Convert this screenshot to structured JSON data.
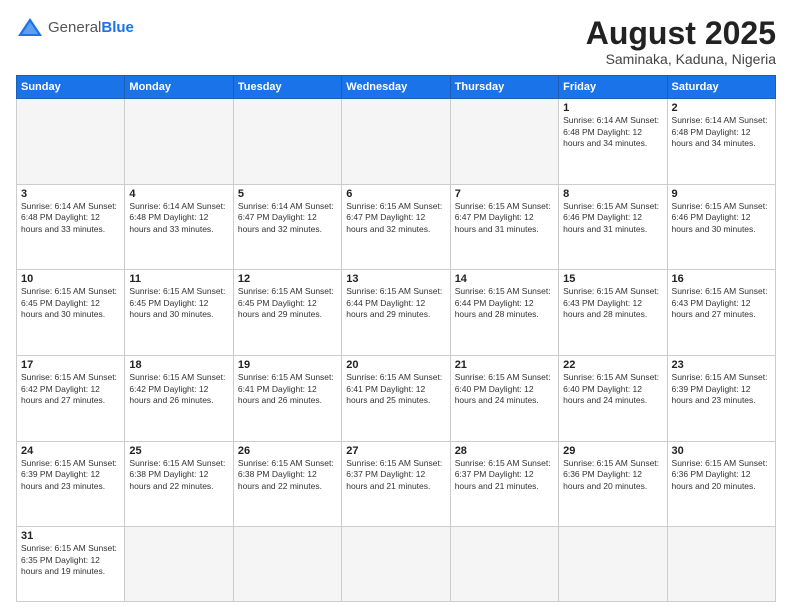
{
  "logo": {
    "text_general": "General",
    "text_blue": "Blue"
  },
  "header": {
    "title": "August 2025",
    "subtitle": "Saminaka, Kaduna, Nigeria"
  },
  "weekdays": [
    "Sunday",
    "Monday",
    "Tuesday",
    "Wednesday",
    "Thursday",
    "Friday",
    "Saturday"
  ],
  "weeks": [
    [
      {
        "day": "",
        "info": ""
      },
      {
        "day": "",
        "info": ""
      },
      {
        "day": "",
        "info": ""
      },
      {
        "day": "",
        "info": ""
      },
      {
        "day": "",
        "info": ""
      },
      {
        "day": "1",
        "info": "Sunrise: 6:14 AM\nSunset: 6:48 PM\nDaylight: 12 hours\nand 34 minutes."
      },
      {
        "day": "2",
        "info": "Sunrise: 6:14 AM\nSunset: 6:48 PM\nDaylight: 12 hours\nand 34 minutes."
      }
    ],
    [
      {
        "day": "3",
        "info": "Sunrise: 6:14 AM\nSunset: 6:48 PM\nDaylight: 12 hours\nand 33 minutes."
      },
      {
        "day": "4",
        "info": "Sunrise: 6:14 AM\nSunset: 6:48 PM\nDaylight: 12 hours\nand 33 minutes."
      },
      {
        "day": "5",
        "info": "Sunrise: 6:14 AM\nSunset: 6:47 PM\nDaylight: 12 hours\nand 32 minutes."
      },
      {
        "day": "6",
        "info": "Sunrise: 6:15 AM\nSunset: 6:47 PM\nDaylight: 12 hours\nand 32 minutes."
      },
      {
        "day": "7",
        "info": "Sunrise: 6:15 AM\nSunset: 6:47 PM\nDaylight: 12 hours\nand 31 minutes."
      },
      {
        "day": "8",
        "info": "Sunrise: 6:15 AM\nSunset: 6:46 PM\nDaylight: 12 hours\nand 31 minutes."
      },
      {
        "day": "9",
        "info": "Sunrise: 6:15 AM\nSunset: 6:46 PM\nDaylight: 12 hours\nand 30 minutes."
      }
    ],
    [
      {
        "day": "10",
        "info": "Sunrise: 6:15 AM\nSunset: 6:45 PM\nDaylight: 12 hours\nand 30 minutes."
      },
      {
        "day": "11",
        "info": "Sunrise: 6:15 AM\nSunset: 6:45 PM\nDaylight: 12 hours\nand 30 minutes."
      },
      {
        "day": "12",
        "info": "Sunrise: 6:15 AM\nSunset: 6:45 PM\nDaylight: 12 hours\nand 29 minutes."
      },
      {
        "day": "13",
        "info": "Sunrise: 6:15 AM\nSunset: 6:44 PM\nDaylight: 12 hours\nand 29 minutes."
      },
      {
        "day": "14",
        "info": "Sunrise: 6:15 AM\nSunset: 6:44 PM\nDaylight: 12 hours\nand 28 minutes."
      },
      {
        "day": "15",
        "info": "Sunrise: 6:15 AM\nSunset: 6:43 PM\nDaylight: 12 hours\nand 28 minutes."
      },
      {
        "day": "16",
        "info": "Sunrise: 6:15 AM\nSunset: 6:43 PM\nDaylight: 12 hours\nand 27 minutes."
      }
    ],
    [
      {
        "day": "17",
        "info": "Sunrise: 6:15 AM\nSunset: 6:42 PM\nDaylight: 12 hours\nand 27 minutes."
      },
      {
        "day": "18",
        "info": "Sunrise: 6:15 AM\nSunset: 6:42 PM\nDaylight: 12 hours\nand 26 minutes."
      },
      {
        "day": "19",
        "info": "Sunrise: 6:15 AM\nSunset: 6:41 PM\nDaylight: 12 hours\nand 26 minutes."
      },
      {
        "day": "20",
        "info": "Sunrise: 6:15 AM\nSunset: 6:41 PM\nDaylight: 12 hours\nand 25 minutes."
      },
      {
        "day": "21",
        "info": "Sunrise: 6:15 AM\nSunset: 6:40 PM\nDaylight: 12 hours\nand 24 minutes."
      },
      {
        "day": "22",
        "info": "Sunrise: 6:15 AM\nSunset: 6:40 PM\nDaylight: 12 hours\nand 24 minutes."
      },
      {
        "day": "23",
        "info": "Sunrise: 6:15 AM\nSunset: 6:39 PM\nDaylight: 12 hours\nand 23 minutes."
      }
    ],
    [
      {
        "day": "24",
        "info": "Sunrise: 6:15 AM\nSunset: 6:39 PM\nDaylight: 12 hours\nand 23 minutes."
      },
      {
        "day": "25",
        "info": "Sunrise: 6:15 AM\nSunset: 6:38 PM\nDaylight: 12 hours\nand 22 minutes."
      },
      {
        "day": "26",
        "info": "Sunrise: 6:15 AM\nSunset: 6:38 PM\nDaylight: 12 hours\nand 22 minutes."
      },
      {
        "day": "27",
        "info": "Sunrise: 6:15 AM\nSunset: 6:37 PM\nDaylight: 12 hours\nand 21 minutes."
      },
      {
        "day": "28",
        "info": "Sunrise: 6:15 AM\nSunset: 6:37 PM\nDaylight: 12 hours\nand 21 minutes."
      },
      {
        "day": "29",
        "info": "Sunrise: 6:15 AM\nSunset: 6:36 PM\nDaylight: 12 hours\nand 20 minutes."
      },
      {
        "day": "30",
        "info": "Sunrise: 6:15 AM\nSunset: 6:36 PM\nDaylight: 12 hours\nand 20 minutes."
      }
    ],
    [
      {
        "day": "31",
        "info": "Sunrise: 6:15 AM\nSunset: 6:35 PM\nDaylight: 12 hours\nand 19 minutes."
      },
      {
        "day": "",
        "info": ""
      },
      {
        "day": "",
        "info": ""
      },
      {
        "day": "",
        "info": ""
      },
      {
        "day": "",
        "info": ""
      },
      {
        "day": "",
        "info": ""
      },
      {
        "day": "",
        "info": ""
      }
    ]
  ]
}
